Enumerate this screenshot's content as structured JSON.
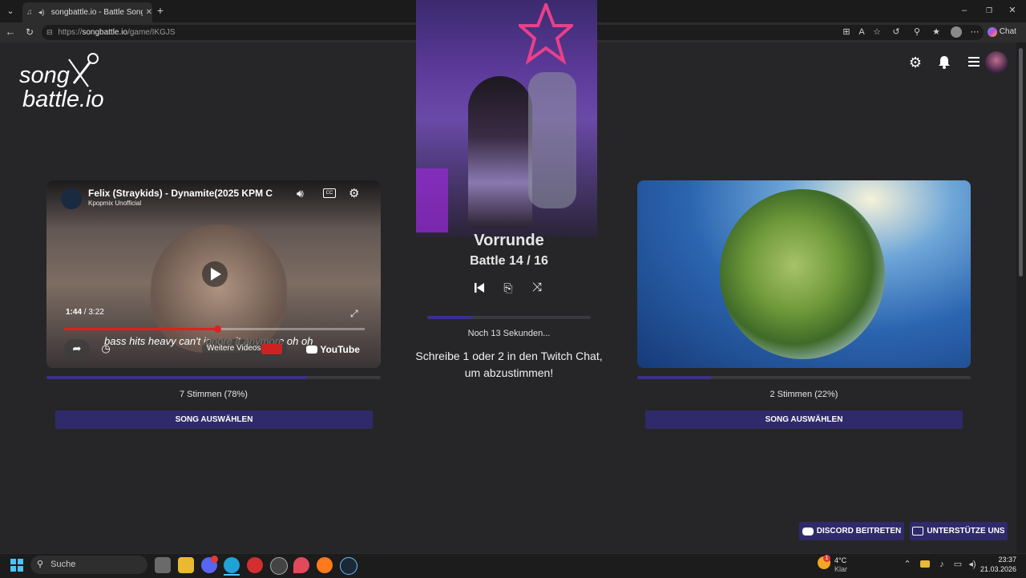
{
  "browser": {
    "tab_title": "songbattle.io - Battle Songs a",
    "url_prefix": "https://",
    "url_domain": "songbattle.io",
    "url_path": "/game/IKGJS",
    "chat_label": "Chat"
  },
  "brand": {
    "line1": "song",
    "line2": "battle.io"
  },
  "center": {
    "round_title": "Vorrunde",
    "battle_label": "Battle 14 / 16",
    "progress": 0.28,
    "timer_text": "Noch 13 Sekunden...",
    "instruction_line1": "Schreibe 1 oder 2 in den Twitch Chat,",
    "instruction_line2": "um abzustimmen!"
  },
  "left_song": {
    "video_title": "Felix (Straykids) - Dynamite(2025 KPM C",
    "channel": "Kpopmix Unofficial",
    "time_current": "1:44",
    "time_total": "3:22",
    "time_separator": " / ",
    "subtitle": "bass hits heavy can't ignore it anymore oh oh",
    "more_videos": "Weitere Videos",
    "youtube_label": "YouTube",
    "playback_progress": 0.51,
    "vote_share": 0.78,
    "votes_text": "7 Stimmen (78%)",
    "select_label": "SONG AUSWÄHLEN",
    "cc_label": "CC"
  },
  "right_song": {
    "vote_share": 0.22,
    "votes_text": "2 Stimmen (22%)",
    "select_label": "SONG AUSWÄHLEN"
  },
  "footer": {
    "discord_label": "DISCORD BEITRETEN",
    "support_label": "UNTERSTÜTZE UNS"
  },
  "taskbar": {
    "search_label": "Suche",
    "weather_temp": "4°C",
    "weather_desc": "Klar",
    "clock_time": "23:37",
    "clock_date": "21.03.2026",
    "badge_count": "1"
  },
  "colors": {
    "accent": "#2f2a6a",
    "progress_fill": "#3b2f8f",
    "page_bg": "#262628"
  }
}
